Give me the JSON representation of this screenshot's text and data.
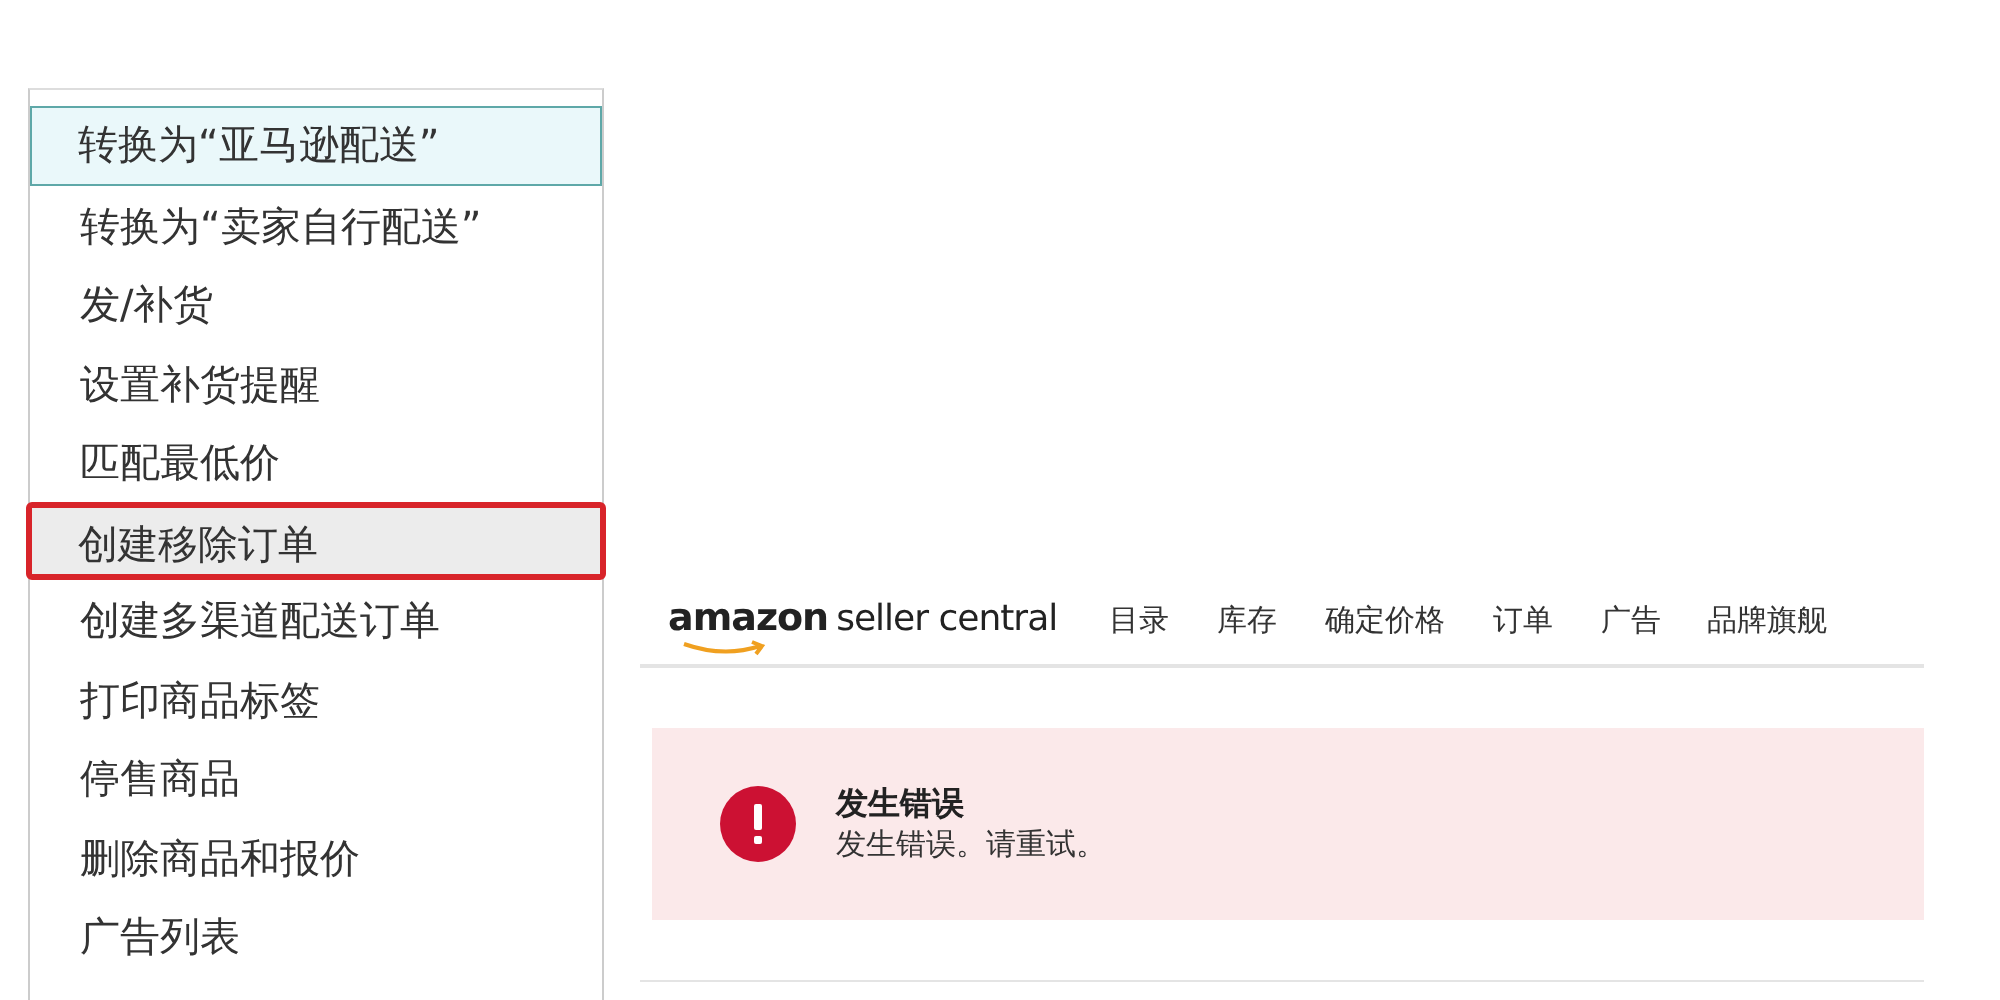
{
  "menu": {
    "items": [
      {
        "label": "转换为“亚马逊配送”",
        "selected": true,
        "marked": false
      },
      {
        "label": "转换为“卖家自行配送”",
        "selected": false,
        "marked": false
      },
      {
        "label": "发/补货",
        "selected": false,
        "marked": false
      },
      {
        "label": "设置补货提醒",
        "selected": false,
        "marked": false
      },
      {
        "label": "匹配最低价",
        "selected": false,
        "marked": false
      },
      {
        "label": "创建移除订单",
        "selected": false,
        "marked": true
      },
      {
        "label": "创建多渠道配送订单",
        "selected": false,
        "marked": false
      },
      {
        "label": "打印商品标签",
        "selected": false,
        "marked": false
      },
      {
        "label": "停售商品",
        "selected": false,
        "marked": false
      },
      {
        "label": "删除商品和报价",
        "selected": false,
        "marked": false
      },
      {
        "label": "广告列表",
        "selected": false,
        "marked": false
      }
    ]
  },
  "header": {
    "logo_brand": "amazon",
    "logo_product": "seller central",
    "nav": [
      "目录",
      "库存",
      "确定价格",
      "订单",
      "广告",
      "品牌旗舰"
    ]
  },
  "alert": {
    "title": "发生错误",
    "message": "发生错误。请重试。"
  }
}
